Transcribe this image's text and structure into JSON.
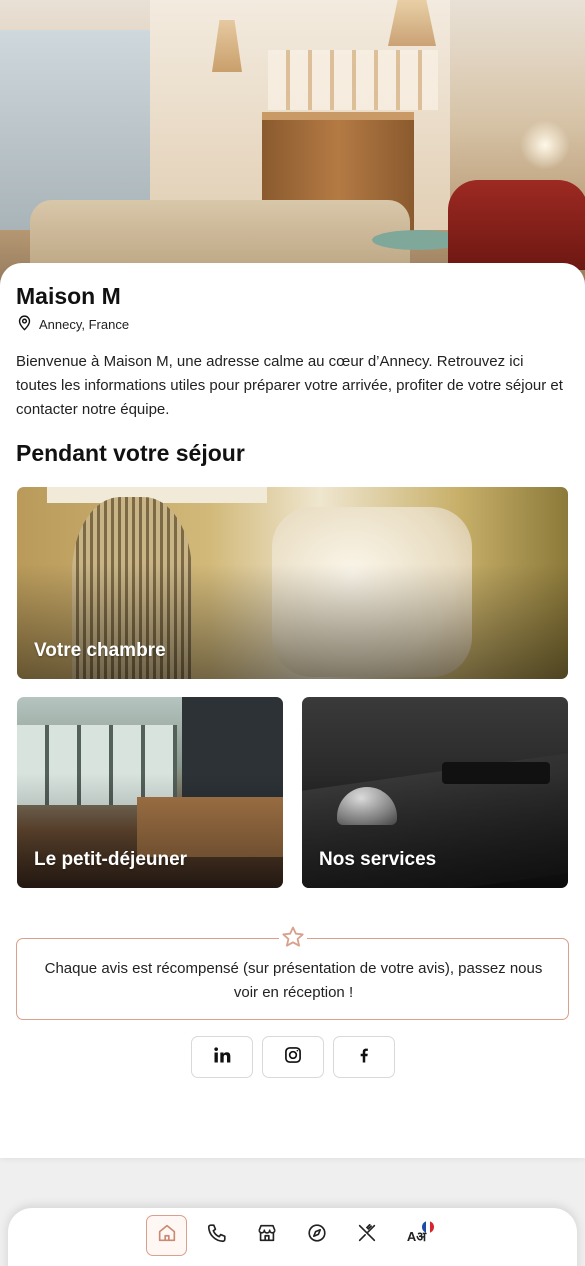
{
  "hotel": {
    "name": "Maison M",
    "location": "Annecy, France",
    "intro": "Bienvenue à Maison M, une adresse calme au cœur d’Annecy. Retrouvez ici toutes les informations utiles pour préparer votre arrivée, profiter de votre séjour et contacter notre équipe."
  },
  "stay": {
    "section_title": "Pendant votre séjour",
    "tiles": [
      {
        "label": "Votre chambre"
      },
      {
        "label": "Le petit-déjeuner"
      },
      {
        "label": "Nos services"
      }
    ]
  },
  "review": {
    "text": "Chaque avis est récompensé (sur présentation de votre avis), passez nous voir en réception !"
  },
  "socials": [
    "linkedin-icon",
    "instagram-icon",
    "facebook-icon"
  ],
  "nav": {
    "items": [
      "home-icon",
      "phone-icon",
      "store-icon",
      "compass-icon",
      "restaurant-icon",
      "language-icon"
    ],
    "active": "home-icon",
    "language_glyph": "Aअ"
  },
  "colors": {
    "accent": "#d9a08b",
    "text": "#111111",
    "background": "#efefef"
  }
}
